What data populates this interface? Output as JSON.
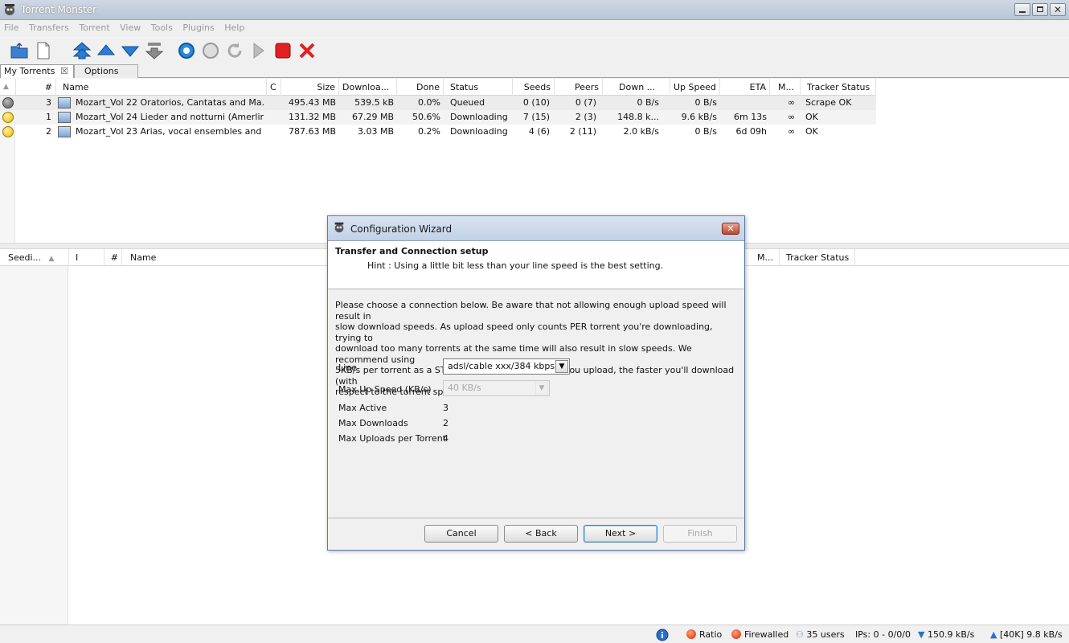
{
  "window": {
    "title": "Torrent Monster"
  },
  "menu": [
    "File",
    "Transfers",
    "Torrent",
    "View",
    "Tools",
    "Plugins",
    "Help"
  ],
  "tabs": {
    "my_torrents": "My Torrents",
    "options": "Options"
  },
  "upper_table": {
    "headers": [
      "#",
      "Name",
      "C",
      "Size",
      "Downloa...",
      "Done",
      "Status",
      "Seeds",
      "Peers",
      "Down ...",
      "Up Speed",
      "ETA",
      "M...",
      "Tracker Status"
    ],
    "rows": [
      {
        "num": "3",
        "name": "Mozart_Vol 22 Oratorios, Cantatas and Ma...",
        "size": "495.43 MB",
        "downloaded": "539.5 kB",
        "done": "0.0%",
        "status": "Queued",
        "seeds": "0 (10)",
        "peers": "0 (7)",
        "down": "0 B/s",
        "up": "0 B/s",
        "eta": "",
        "m": "∞",
        "tracker": "Scrape OK"
      },
      {
        "num": "1",
        "name": "Mozart_Vol 24 Lieder and notturni (Amerlin...",
        "size": "131.32 MB",
        "downloaded": "67.29 MB",
        "done": "50.6%",
        "status": "Downloading",
        "seeds": "7 (15)",
        "peers": "2 (3)",
        "down": "148.8 k...",
        "up": "9.6 kB/s",
        "eta": "6m 13s",
        "m": "∞",
        "tracker": "OK"
      },
      {
        "num": "2",
        "name": "Mozart_Vol 23 Arias, vocal ensembles and ...",
        "size": "787.63 MB",
        "downloaded": "3.03 MB",
        "done": "0.2%",
        "status": "Downloading",
        "seeds": "4 (6)",
        "peers": "2 (11)",
        "down": "2.0 kB/s",
        "up": "0 B/s",
        "eta": "6d 09h",
        "m": "∞",
        "tracker": "OK"
      }
    ]
  },
  "lower_table": {
    "headers": [
      "Seedi...",
      "I",
      "#",
      "Name",
      "M...",
      "Tracker Status"
    ]
  },
  "dialog": {
    "title": "Configuration Wizard",
    "heading": "Transfer and Connection setup",
    "hint": "Hint : Using a little bit less than your line speed is the best setting.",
    "body_lines": [
      "Please choose a connection below. Be aware that not allowing enough upload speed will result in",
      "slow download speeds. As upload speed only counts PER torrent you're downloading, trying to",
      "download too many torrents at the same time will also result in slow speeds. We recommend using",
      "5KB/s per torrent as a STRICT minimum. The faster you upload, the faster you'll download (with",
      "respect to the torrent speed)."
    ],
    "line_label": "Line",
    "line_value": "adsl/cable xxx/384 kbps",
    "max_up_label": "Max Up Speed (KB/s)",
    "max_up_value": "40 KB/s",
    "max_active_label": "Max Active",
    "max_active_value": "3",
    "max_downloads_label": "Max Downloads",
    "max_downloads_value": "2",
    "max_uploads_label": "Max Uploads per Torrent",
    "max_uploads_value": "4",
    "buttons": {
      "cancel": "Cancel",
      "back": "< Back",
      "next": "Next >",
      "finish": "Finish"
    }
  },
  "statusbar": {
    "ratio": "Ratio",
    "firewalled": "Firewalled",
    "users": "35 users",
    "ips": "IPs: 0 - 0/0/0",
    "down_speed": "150.9 kB/s",
    "up_speed": "[40K] 9.8 kB/s"
  },
  "colors": {
    "accent": "#1a6fc4",
    "alert": "#d42d00"
  }
}
